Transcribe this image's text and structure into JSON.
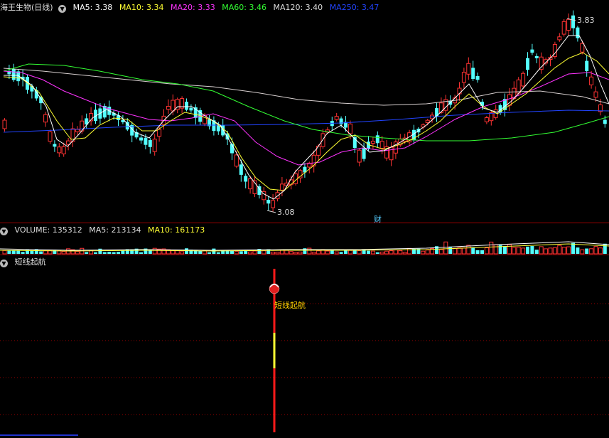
{
  "main": {
    "title": "海王生物(日线)",
    "ma": [
      {
        "label": "MA5: 3.38",
        "color": "#ffffff"
      },
      {
        "label": "MA10: 3.34",
        "color": "#ffff33"
      },
      {
        "label": "MA20: 3.33",
        "color": "#ff33ff"
      },
      {
        "label": "MA60: 3.46",
        "color": "#33ff33"
      },
      {
        "label": "MA120: 3.40",
        "color": "#dddddd"
      },
      {
        "label": "MA250: 3.47",
        "color": "#2244ff"
      }
    ],
    "high_label": "3.83",
    "low_label": "3.08",
    "marker": "财"
  },
  "volume": {
    "label": "VOLUME: 135312",
    "ma5": "MA5: 213134",
    "ma10": "MA10: 161173"
  },
  "indicator": {
    "title": "短线起航",
    "signal_label": "短线起航"
  },
  "colors": {
    "up": "#ff3333",
    "down": "#54ffff",
    "grid": "#9a0000"
  }
}
